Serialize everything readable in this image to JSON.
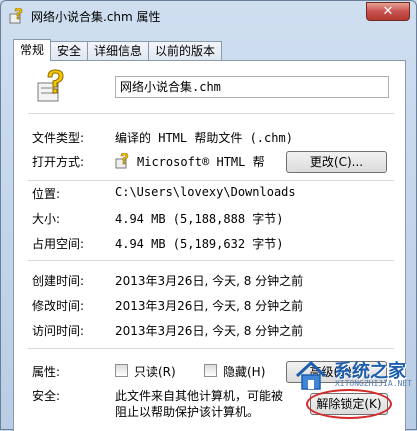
{
  "window": {
    "title": "网络小说合集.chm 属性",
    "close_glyph": "✕"
  },
  "tabs": [
    {
      "label": "常规",
      "active": true
    },
    {
      "label": "安全",
      "active": false
    },
    {
      "label": "详细信息",
      "active": false
    },
    {
      "label": "以前的版本",
      "active": false
    }
  ],
  "general": {
    "file_name": "网络小说合集.chm",
    "file_type_label": "文件类型:",
    "file_type_value": "编译的 HTML 帮助文件 (.chm)",
    "open_with_label": "打开方式:",
    "open_with_value": "Microsoft® HTML 帮",
    "change_button": "更改(C)...",
    "location_label": "位置:",
    "location_value": "C:\\Users\\lovexy\\Downloads",
    "size_label": "大小:",
    "size_value": "4.94 MB (5,188,888 字节)",
    "disk_size_label": "占用空间:",
    "disk_size_value": "4.94 MB (5,189,632 字节)",
    "created_label": "创建时间:",
    "created_value": "2013年3月26日, 今天, 8 分钟之前",
    "modified_label": "修改时间:",
    "modified_value": "2013年3月26日, 今天, 8 分钟之前",
    "accessed_label": "访问时间:",
    "accessed_value": "2013年3月26日, 今天, 8 分钟之前",
    "attributes_label": "属性:",
    "readonly_label": "只读(R)",
    "hidden_label": "隐藏(H)",
    "advanced_button": "高级(D)...",
    "security_label": "安全:",
    "security_text_line1": "此文件来自其他计算机，可能被",
    "security_text_line2": "阻止以帮助保护该计算机。",
    "unblock_button": "解除锁定(K)"
  },
  "watermark": {
    "text": "系统之家",
    "sub": "XITONGZHIJIA.NET"
  },
  "icons": {
    "title": "help-file-icon",
    "large": "help-file-icon",
    "open_with": "help-file-icon"
  },
  "colors": {
    "title_bar": "#cfdff0",
    "close_button": "#c75050",
    "watermark": "#1d5fae",
    "highlight": "#d42a2a"
  }
}
